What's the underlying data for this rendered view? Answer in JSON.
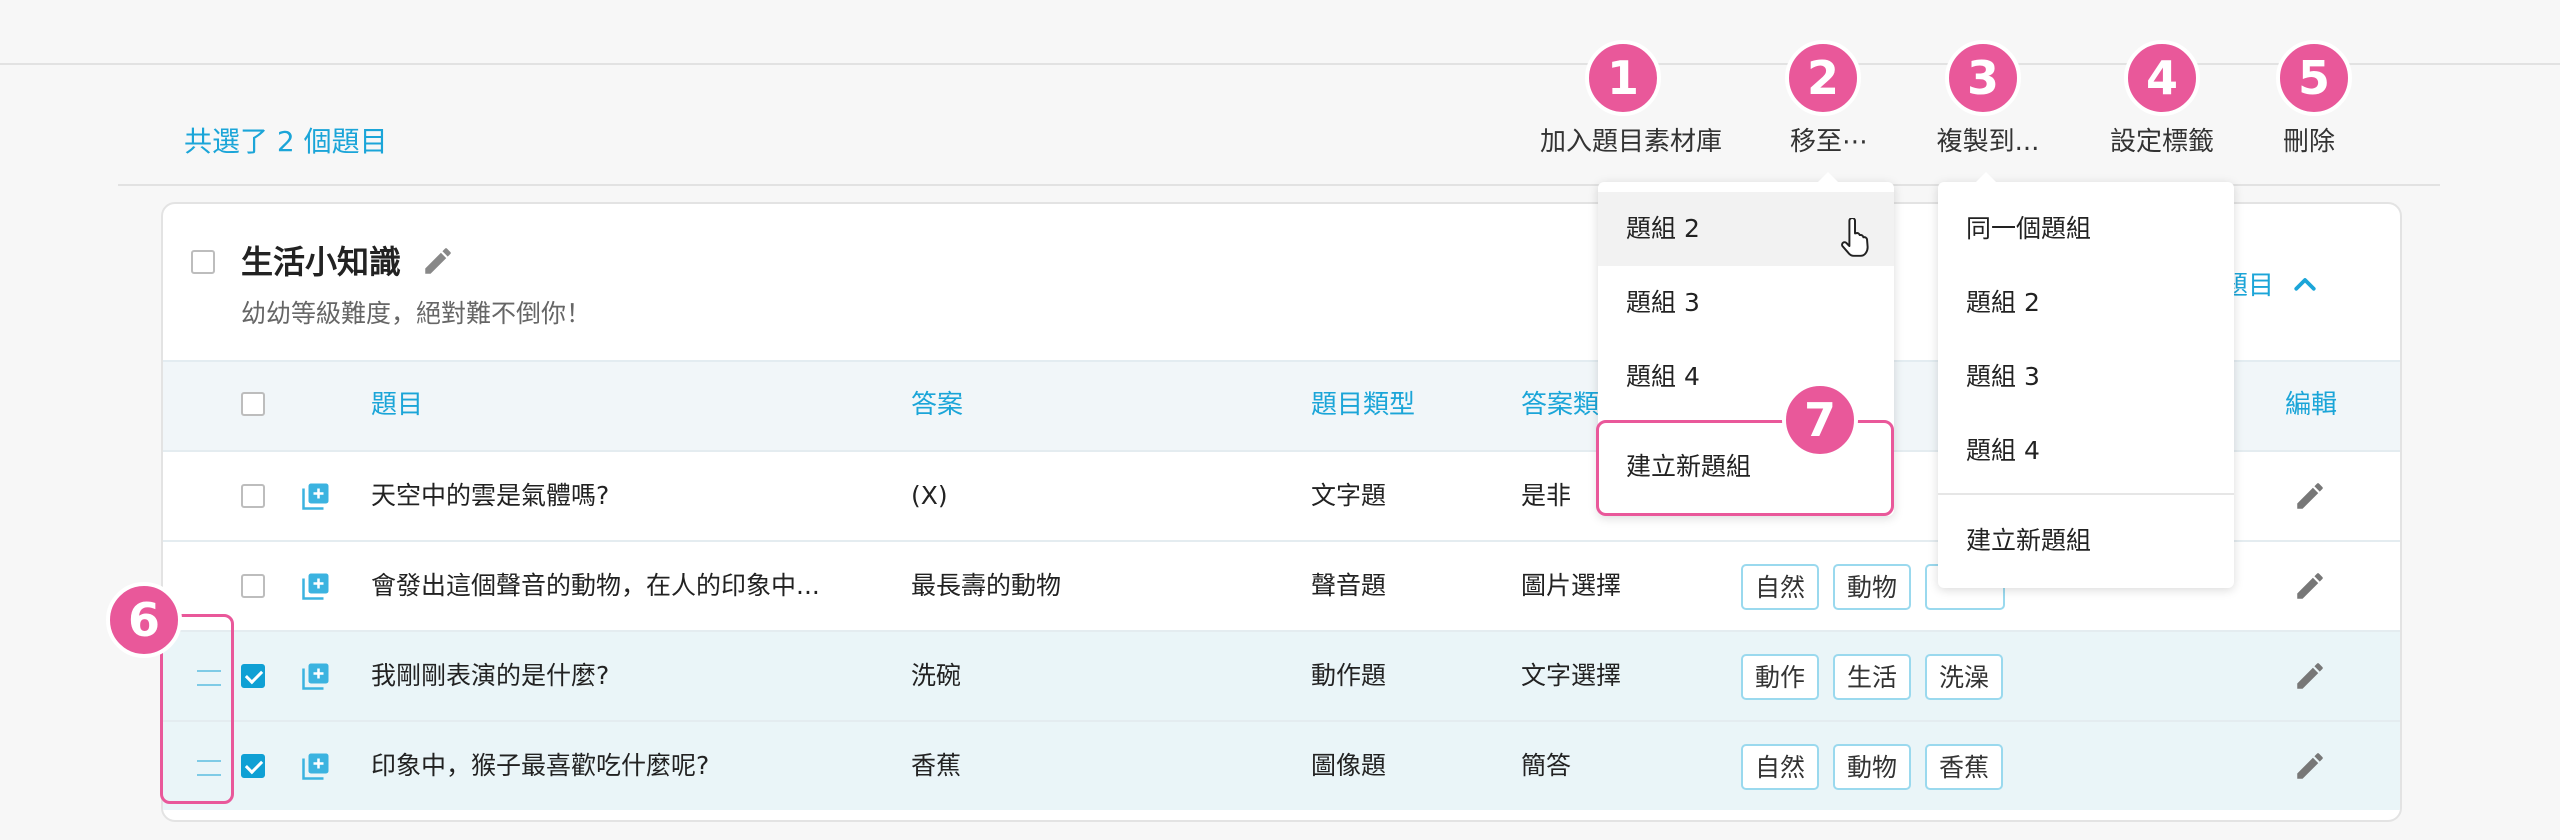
{
  "toolbar": {
    "selection_count": "共選了 2 個題目",
    "add_to_library": "加入題目素材庫",
    "move_to": "移至⋯",
    "copy_to": "複製到...",
    "set_tags": "設定標籤",
    "delete": "刪除"
  },
  "badges": [
    "1",
    "2",
    "3",
    "4",
    "5",
    "6",
    "7"
  ],
  "group": {
    "title": "生活小知識",
    "description": "幼幼等級難度，絕對難不倒你！",
    "collapse_label": "題目"
  },
  "table": {
    "headers": {
      "question": "題目",
      "answer": "答案",
      "type": "題目類型",
      "answer_type": "答案類",
      "edit": "編輯"
    },
    "rows": [
      {
        "question": "天空中的雲是氣體嗎?",
        "answer": "(X)",
        "type": "文字題",
        "answer_type": "是非",
        "selected": false
      },
      {
        "question": "會發出這個聲音的動物，在人的印象中...",
        "answer": "最長壽的動物",
        "type": "聲音題",
        "answer_type": "圖片選擇",
        "tags": [
          "自然",
          "動物"
        ],
        "selected": false
      },
      {
        "question": "我剛剛表演的是什麼?",
        "answer": "洗碗",
        "type": "動作題",
        "answer_type": "文字選擇",
        "tags": [
          "動作",
          "生活",
          "洗澡"
        ],
        "selected": true
      },
      {
        "question": "印象中，猴子最喜歡吃什麼呢?",
        "answer": "香蕉",
        "type": "圖像題",
        "answer_type": "簡答",
        "tags": [
          "自然",
          "動物",
          "香蕉"
        ],
        "selected": true
      }
    ]
  },
  "move_menu": {
    "items": [
      "題組 2",
      "題組 3",
      "題組 4",
      "建立新題組"
    ]
  },
  "copy_menu": {
    "items": [
      "同一個題組",
      "題組 2",
      "題組 3",
      "題組 4",
      "建立新題組"
    ]
  },
  "colors": {
    "accent": "#1ba5d8",
    "highlight": "#e9589a",
    "selected_row": "#eaf5f8"
  }
}
